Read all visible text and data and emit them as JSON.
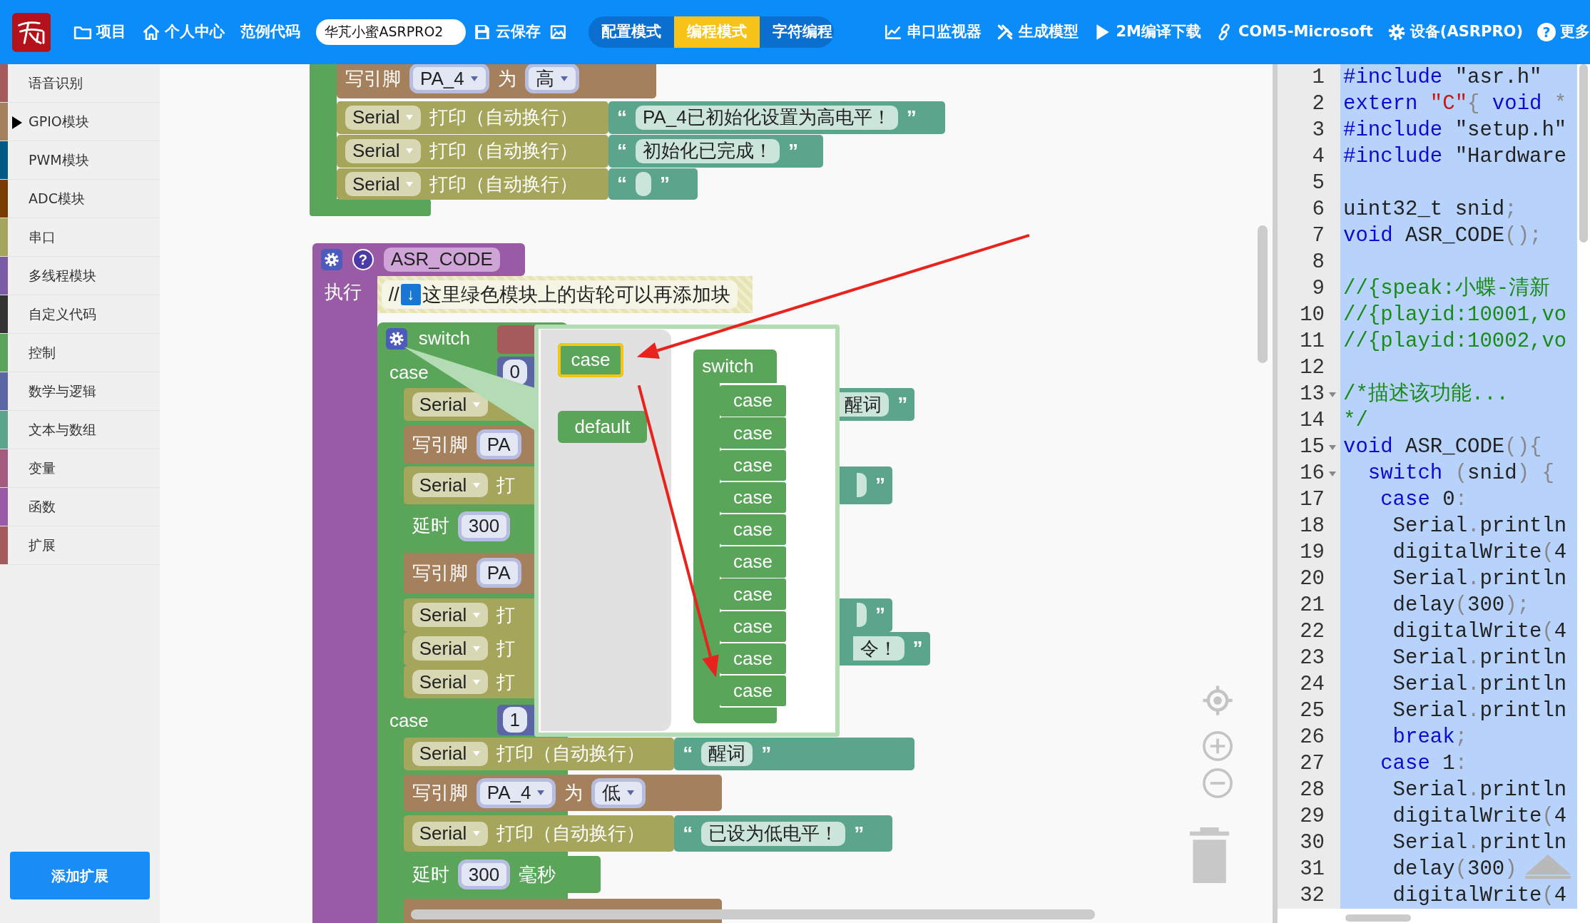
{
  "toolbar": {
    "left_items": [
      {
        "label": "项目"
      },
      {
        "label": "个人中心"
      },
      {
        "label": "范例代码"
      }
    ],
    "project_field": {
      "value": "华芃小蜜ASRPRO2"
    },
    "save": {
      "label": "云保存"
    },
    "modes": [
      {
        "label": "配置模式",
        "selected": false
      },
      {
        "label": "编程模式",
        "selected": true
      },
      {
        "label": "字符编程",
        "selected": false
      }
    ],
    "right_items": [
      {
        "label": "串口监视器"
      },
      {
        "label": "生成模型"
      },
      {
        "label": "2M编译下载"
      },
      {
        "label": "COM5-Microsoft"
      },
      {
        "label": "设备(ASRPRO)"
      },
      {
        "label": "更多",
        "glyph": "?"
      }
    ]
  },
  "sidebar": {
    "categories": [
      {
        "label": "语音识别",
        "color": "#a55b5b",
        "selected": false
      },
      {
        "label": "GPIO模块",
        "color": "#a5805c",
        "selected": true
      },
      {
        "label": "PWM模块",
        "color": "#005a87",
        "selected": false
      },
      {
        "label": "ADC模块",
        "color": "#7a3b00",
        "selected": false
      },
      {
        "label": "串口",
        "color": "#a5a55b",
        "selected": false
      },
      {
        "label": "多线程模块",
        "color": "#7a5ba5",
        "selected": false
      },
      {
        "label": "自定义代码",
        "color": "#333333",
        "selected": false
      },
      {
        "label": "控制",
        "color": "#5ba55b",
        "selected": false
      },
      {
        "label": "数学与逻辑",
        "color": "#5b67a5",
        "selected": false
      },
      {
        "label": "文本与数组",
        "color": "#5ba58c",
        "selected": false
      },
      {
        "label": "变量",
        "color": "#a55b80",
        "selected": false
      },
      {
        "label": "函数",
        "color": "#995ba5",
        "selected": false
      },
      {
        "label": "扩展",
        "color": "#a55b5b",
        "selected": false
      }
    ],
    "add_button": "添加扩展"
  },
  "workspace": {
    "setup_rows": [
      {
        "kind": "pin_write",
        "label": "写引脚",
        "pin": "PA_4",
        "joiner": "为",
        "value": "高"
      },
      {
        "kind": "serial_print",
        "port": "Serial",
        "label": "打印（自动换行）",
        "open_quote": "“",
        "text": "PA_4已初始化设置为高电平！",
        "close_quote": "”"
      },
      {
        "kind": "serial_print",
        "port": "Serial",
        "label": "打印（自动换行）",
        "open_quote": "“",
        "text": "初始化已完成！",
        "close_quote": "”"
      },
      {
        "kind": "serial_print",
        "port": "Serial",
        "label": "打印（自动换行）",
        "open_quote": "“",
        "close_quote": "”"
      }
    ],
    "function": {
      "name": "ASR_CODE",
      "help": "?",
      "body_label": "执行",
      "comment": {
        "prefix": "//",
        "arrow": "↓",
        "text": "这里绿色模块上的齿轮可以再添加块"
      },
      "switch": {
        "label": "switch",
        "cases": [
          {
            "label": "case",
            "value": "0",
            "rows": [
              {
                "kind": "serial_print",
                "port": "Serial",
                "tail": {
                  "text": "醒词",
                  "close_quote": "”"
                }
              },
              {
                "kind": "pin_write",
                "label": "写引脚",
                "pin": "PA"
              },
              {
                "kind": "serial_print",
                "port": "Serial",
                "label": "打",
                "tail": {
                  "close_quote": "”"
                }
              },
              {
                "kind": "delay",
                "label": "延时",
                "ms": "300"
              },
              {
                "kind": "pin_write",
                "label": "写引脚",
                "pin": "PA"
              },
              {
                "kind": "serial_print",
                "port": "Serial",
                "label": "打",
                "tail": {
                  "close_quote": "”"
                }
              },
              {
                "kind": "serial_print",
                "port": "Serial",
                "label": "打",
                "tail": {
                  "text": "令！",
                  "close_quote": "”"
                }
              },
              {
                "kind": "serial_print",
                "port": "Serial",
                "label": "打"
              }
            ]
          },
          {
            "label": "case",
            "value": "1",
            "rows": [
              {
                "kind": "serial_print",
                "port": "Serial",
                "label": "打印（自动换行）",
                "open_quote": "“",
                "text": "醒词",
                "close_quote": "”"
              },
              {
                "kind": "pin_write",
                "label": "写引脚",
                "pin": "PA_4",
                "joiner": "为",
                "value": "低"
              },
              {
                "kind": "serial_print",
                "port": "Serial",
                "label": "打印（自动换行）",
                "open_quote": "“",
                "text": "已设为低电平！",
                "close_quote": "”"
              },
              {
                "kind": "delay",
                "label": "延时",
                "ms": "300",
                "unit": "毫秒"
              },
              {
                "kind": "pin_write"
              }
            ]
          }
        ]
      }
    },
    "mutator": {
      "flyout": [
        {
          "label": "case",
          "selected": true
        },
        {
          "label": "default",
          "selected": false
        }
      ],
      "switch_label": "switch",
      "cases": [
        "case",
        "case",
        "case",
        "case",
        "case",
        "case",
        "case",
        "case",
        "case",
        "case"
      ]
    }
  },
  "code": {
    "selected": true,
    "lines": [
      {
        "number": "1",
        "foldable": false,
        "segments": [
          {
            "kind": "kw",
            "text": "#include"
          },
          {
            "kind": "txt",
            "text": " \"asr.h\""
          }
        ]
      },
      {
        "number": "2",
        "foldable": false,
        "segments": [
          {
            "kind": "kw",
            "text": "extern"
          },
          {
            "kind": "str",
            "text": " \"C\""
          },
          {
            "kind": "pun",
            "text": "{"
          },
          {
            "kind": "kw",
            "text": " void"
          },
          {
            "kind": "pun",
            "text": " *"
          }
        ]
      },
      {
        "number": "3",
        "foldable": false,
        "segments": [
          {
            "kind": "kw",
            "text": "#include"
          },
          {
            "kind": "txt",
            "text": " \"setup.h\""
          }
        ]
      },
      {
        "number": "4",
        "foldable": false,
        "segments": [
          {
            "kind": "kw",
            "text": "#include"
          },
          {
            "kind": "txt",
            "text": " \"Hardware"
          }
        ]
      },
      {
        "number": "5",
        "foldable": false
      },
      {
        "number": "6",
        "foldable": false,
        "segments": [
          {
            "kind": "txt",
            "text": "uint32_t snid"
          },
          {
            "kind": "pun",
            "text": ";"
          }
        ]
      },
      {
        "number": "7",
        "foldable": false,
        "segments": [
          {
            "kind": "kw",
            "text": "void"
          },
          {
            "kind": "txt",
            "text": " ASR_CODE"
          },
          {
            "kind": "pun",
            "text": "();"
          }
        ]
      },
      {
        "number": "8",
        "foldable": false
      },
      {
        "number": "9",
        "foldable": false,
        "segments": [
          {
            "kind": "com",
            "text": "//{speak:小蝶-清新"
          }
        ]
      },
      {
        "number": "10",
        "foldable": false,
        "segments": [
          {
            "kind": "com",
            "text": "//{playid:10001,vo"
          }
        ]
      },
      {
        "number": "11",
        "foldable": false,
        "segments": [
          {
            "kind": "com",
            "text": "//{playid:10002,vo"
          }
        ]
      },
      {
        "number": "12",
        "foldable": false
      },
      {
        "number": "13",
        "foldable": true,
        "segments": [
          {
            "kind": "com",
            "text": "/*描述该功能..."
          }
        ]
      },
      {
        "number": "14",
        "foldable": false,
        "segments": [
          {
            "kind": "com",
            "text": "*/"
          }
        ]
      },
      {
        "number": "15",
        "foldable": true,
        "segments": [
          {
            "kind": "kw",
            "text": "void"
          },
          {
            "kind": "txt",
            "text": " ASR_CODE"
          },
          {
            "kind": "pun",
            "text": "(){"
          }
        ]
      },
      {
        "number": "16",
        "foldable": true,
        "segments": [
          {
            "kind": "kw",
            "text": "  switch"
          },
          {
            "kind": "pun",
            "text": " ("
          },
          {
            "kind": "txt",
            "text": "snid"
          },
          {
            "kind": "pun",
            "text": ") {"
          }
        ]
      },
      {
        "number": "17",
        "foldable": false,
        "segments": [
          {
            "kind": "kw",
            "text": "   case"
          },
          {
            "kind": "txt",
            "text": " 0"
          },
          {
            "kind": "pun",
            "text": ":"
          }
        ]
      },
      {
        "number": "18",
        "foldable": false,
        "segments": [
          {
            "kind": "txt",
            "text": "    Serial"
          },
          {
            "kind": "pun",
            "text": "."
          },
          {
            "kind": "txt",
            "text": "println"
          }
        ]
      },
      {
        "number": "19",
        "foldable": false,
        "segments": [
          {
            "kind": "txt",
            "text": "    digitalWrite"
          },
          {
            "kind": "pun",
            "text": "("
          },
          {
            "kind": "txt",
            "text": "4"
          }
        ]
      },
      {
        "number": "20",
        "foldable": false,
        "segments": [
          {
            "kind": "txt",
            "text": "    Serial"
          },
          {
            "kind": "pun",
            "text": "."
          },
          {
            "kind": "txt",
            "text": "println"
          }
        ]
      },
      {
        "number": "21",
        "foldable": false,
        "segments": [
          {
            "kind": "txt",
            "text": "    delay"
          },
          {
            "kind": "pun",
            "text": "("
          },
          {
            "kind": "txt",
            "text": "300"
          },
          {
            "kind": "pun",
            "text": ");"
          }
        ]
      },
      {
        "number": "22",
        "foldable": false,
        "segments": [
          {
            "kind": "txt",
            "text": "    digitalWrite"
          },
          {
            "kind": "pun",
            "text": "("
          },
          {
            "kind": "txt",
            "text": "4"
          }
        ]
      },
      {
        "number": "23",
        "foldable": false,
        "segments": [
          {
            "kind": "txt",
            "text": "    Serial"
          },
          {
            "kind": "pun",
            "text": "."
          },
          {
            "kind": "txt",
            "text": "println"
          }
        ]
      },
      {
        "number": "24",
        "foldable": false,
        "segments": [
          {
            "kind": "txt",
            "text": "    Serial"
          },
          {
            "kind": "pun",
            "text": "."
          },
          {
            "kind": "txt",
            "text": "println"
          }
        ]
      },
      {
        "number": "25",
        "foldable": false,
        "segments": [
          {
            "kind": "txt",
            "text": "    Serial"
          },
          {
            "kind": "pun",
            "text": "."
          },
          {
            "kind": "txt",
            "text": "println"
          }
        ]
      },
      {
        "number": "26",
        "foldable": false,
        "segments": [
          {
            "kind": "kw",
            "text": "    break"
          },
          {
            "kind": "pun",
            "text": ";"
          }
        ]
      },
      {
        "number": "27",
        "foldable": false,
        "segments": [
          {
            "kind": "kw",
            "text": "   case"
          },
          {
            "kind": "txt",
            "text": " 1"
          },
          {
            "kind": "pun",
            "text": ":"
          }
        ]
      },
      {
        "number": "28",
        "foldable": false,
        "segments": [
          {
            "kind": "txt",
            "text": "    Serial"
          },
          {
            "kind": "pun",
            "text": "."
          },
          {
            "kind": "txt",
            "text": "println"
          }
        ]
      },
      {
        "number": "29",
        "foldable": false,
        "segments": [
          {
            "kind": "txt",
            "text": "    digitalWrite"
          },
          {
            "kind": "pun",
            "text": "("
          },
          {
            "kind": "txt",
            "text": "4"
          }
        ]
      },
      {
        "number": "30",
        "foldable": false,
        "segments": [
          {
            "kind": "txt",
            "text": "    Serial"
          },
          {
            "kind": "pun",
            "text": "."
          },
          {
            "kind": "txt",
            "text": "println"
          }
        ]
      },
      {
        "number": "31",
        "foldable": false,
        "segments": [
          {
            "kind": "txt",
            "text": "    delay"
          },
          {
            "kind": "pun",
            "text": "("
          },
          {
            "kind": "txt",
            "text": "300"
          },
          {
            "kind": "pun",
            "text": ")"
          }
        ]
      },
      {
        "number": "32",
        "foldable": false,
        "segments": [
          {
            "kind": "txt",
            "text": "    digitalWrite"
          },
          {
            "kind": "pun",
            "text": "("
          },
          {
            "kind": "txt",
            "text": "4"
          }
        ]
      }
    ]
  }
}
